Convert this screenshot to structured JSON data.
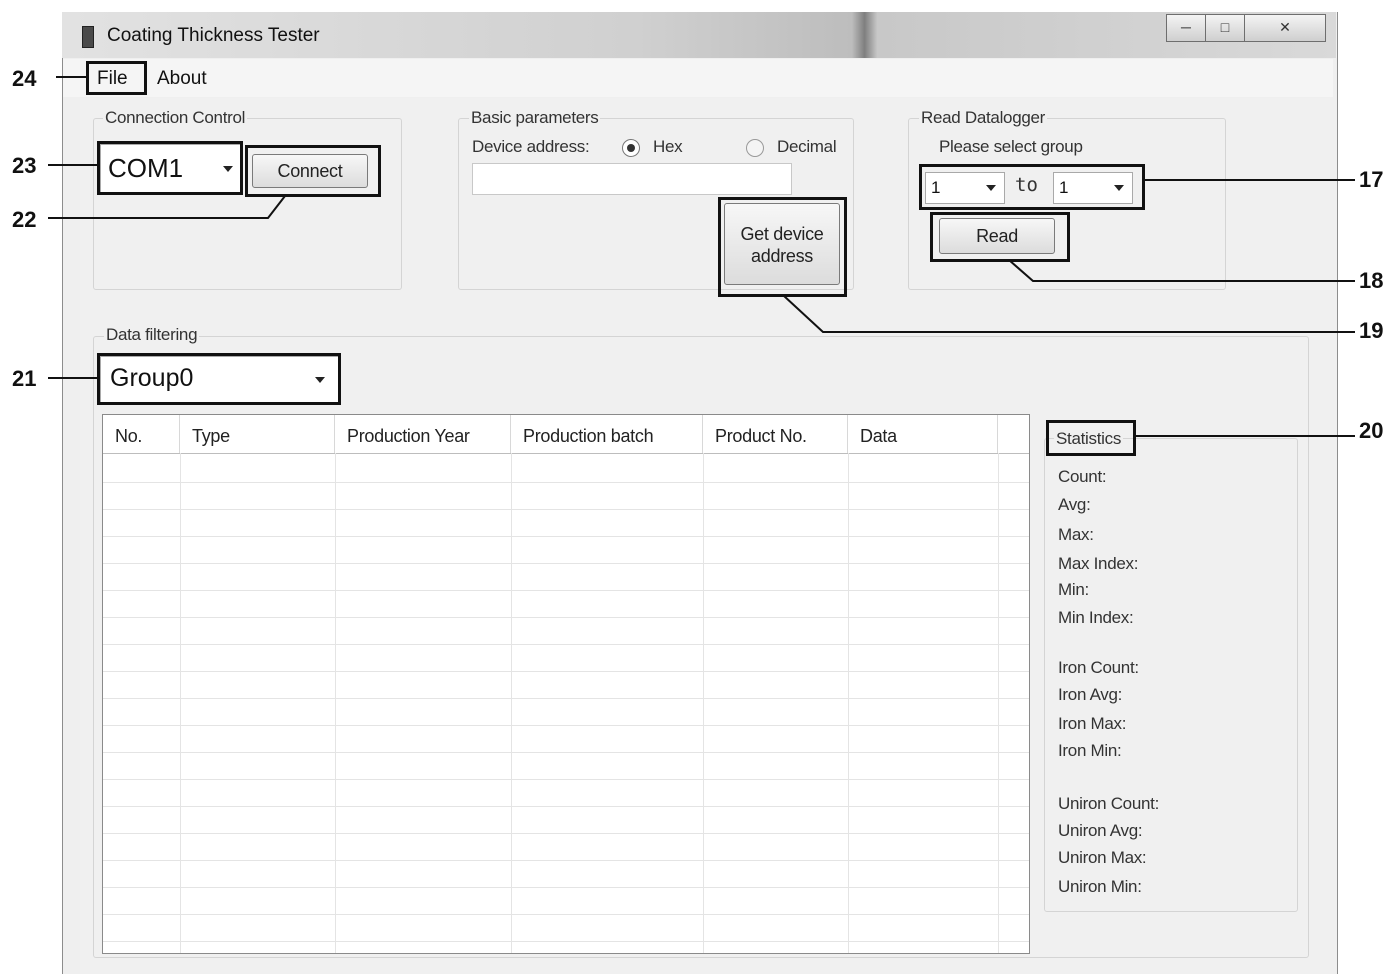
{
  "window": {
    "title": "Coating Thickness Tester",
    "caption_buttons": [
      "minimize-icon",
      "maximize-icon",
      "close-icon"
    ]
  },
  "menu": {
    "items": [
      "File",
      "About"
    ]
  },
  "connection": {
    "group_label": "Connection Control",
    "port": "COM1",
    "connect_label": "Connect"
  },
  "basic": {
    "group_label": "Basic parameters",
    "address_label": "Device address:",
    "hex_label": "Hex",
    "decimal_label": "Decimal",
    "selected_radio": "Hex",
    "address_value": "",
    "get_address_line1": "Get device",
    "get_address_line2": "address"
  },
  "datalogger": {
    "group_label": "Read Datalogger",
    "select_label": "Please select group",
    "from": "1",
    "to_label": "to",
    "to": "1",
    "read_label": "Read"
  },
  "filtering": {
    "group_label": "Data filtering",
    "group_value": "Group0"
  },
  "table": {
    "columns": [
      "No.",
      "Type",
      "Production Year",
      "Production batch",
      "Product No.",
      "Data"
    ]
  },
  "statistics": {
    "label": "Statistics",
    "block1": [
      "Count:",
      "Avg:",
      "Max:",
      "Max Index:",
      "Min:",
      "Min Index:"
    ],
    "block2": [
      "Iron Count:",
      "Iron Avg:",
      "Iron Max:",
      "Iron Min:"
    ],
    "block3": [
      "Uniron Count:",
      "Uniron Avg:",
      "Uniron Max:",
      "Uniron Min:"
    ]
  },
  "callouts": [
    "24",
    "23",
    "22",
    "21",
    "17",
    "18",
    "19",
    "20"
  ]
}
